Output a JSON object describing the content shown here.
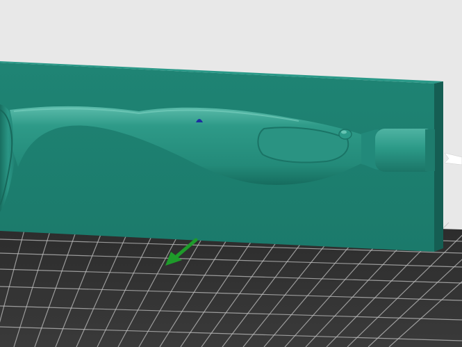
{
  "viewport": {
    "background_color": "#e8e8e8",
    "build_plate_color": "#323232",
    "grid_line_color": "#bfbfbf"
  },
  "mold": {
    "color": "#1f8070",
    "edge_color": "#18655a",
    "top_face_color": "#2a8f7e"
  },
  "model": {
    "shape": "fishing-lure-body",
    "body_color": "#27907f",
    "highlight_color": "#5fbfae",
    "shadow_color": "#136a5c"
  },
  "gizmo": {
    "y_axis_arrow_color": "#1e9b2a",
    "marker_color": "#1c2fa0",
    "icons": [
      "y-axis-arrow-icon",
      "point-marker-icon",
      "cursor-arrow-icon"
    ]
  }
}
